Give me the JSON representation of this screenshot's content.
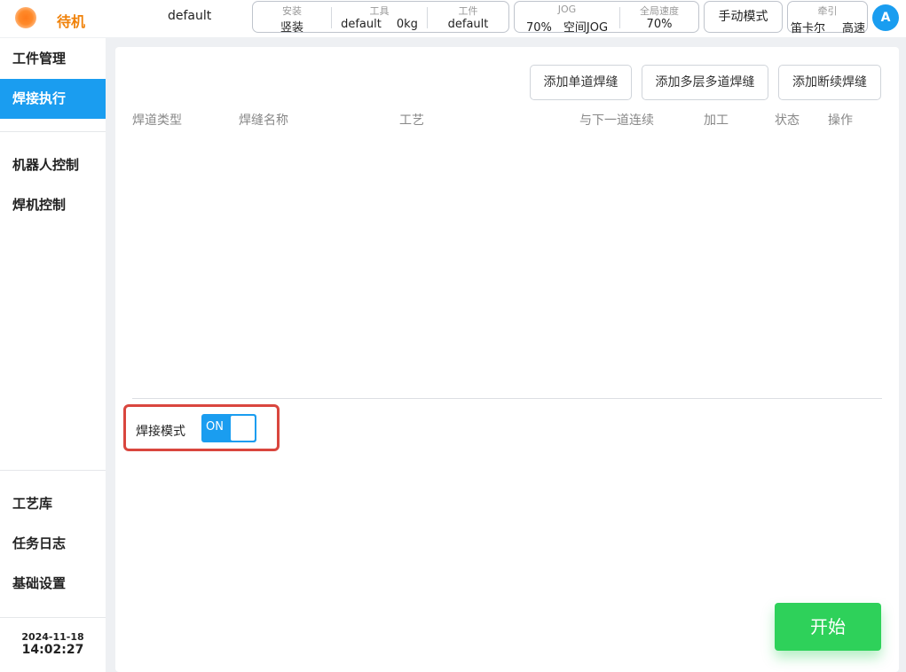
{
  "status": {
    "text": "待机",
    "color": "#f0820a",
    "indicator": "status-dot-icon"
  },
  "program": {
    "name": "default"
  },
  "info_install": {
    "label": "安装",
    "value": "竖装"
  },
  "info_tool": {
    "label": "工具",
    "name": "default",
    "weight": "0kg"
  },
  "info_workpiece": {
    "label": "工件",
    "value": "default"
  },
  "info_jog": {
    "label": "JOG",
    "percent": "70%",
    "mode": "空间JOG"
  },
  "info_speed": {
    "label": "全局速度",
    "value": "70%"
  },
  "mode_button": {
    "label": "手动模式"
  },
  "traction": {
    "label": "牵引",
    "coord": "笛卡尔",
    "speed": "高速"
  },
  "user": {
    "avatar_letter": "A"
  },
  "sidebar": {
    "items": [
      {
        "label": "工件管理",
        "active": false
      },
      {
        "label": "焊接执行",
        "active": true
      },
      {
        "label": "机器人控制",
        "active": false
      },
      {
        "label": "焊机控制",
        "active": false
      }
    ],
    "bottom_items": [
      {
        "label": "工艺库"
      },
      {
        "label": "任务日志"
      },
      {
        "label": "基础设置"
      }
    ],
    "date": "2024-11-18",
    "time": "14:02:27"
  },
  "main": {
    "actions": [
      {
        "label": "添加单道焊缝"
      },
      {
        "label": "添加多层多道焊缝"
      },
      {
        "label": "添加断续焊缝"
      }
    ],
    "columns": [
      "焊道类型",
      "焊缝名称",
      "工艺",
      "与下一道连续",
      "加工",
      "状态",
      "操作"
    ],
    "rows": [],
    "weld_mode": {
      "label": "焊接模式",
      "toggle_text": "ON",
      "on": true
    },
    "start_button": {
      "label": "开始"
    }
  },
  "colors": {
    "accent": "#1a9df0",
    "start": "#2ed15a",
    "highlight": "#d9463e"
  }
}
